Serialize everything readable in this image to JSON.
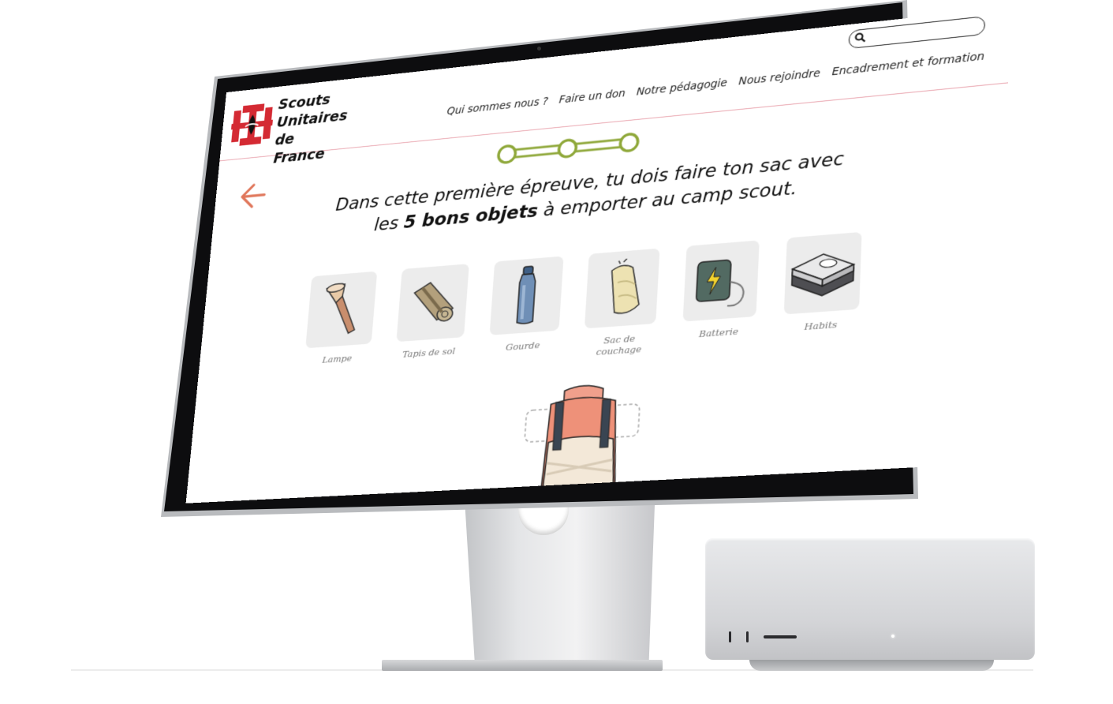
{
  "site": {
    "brand_lines": [
      "Scouts",
      "Unitaires de",
      "France"
    ],
    "search": {
      "placeholder": ""
    },
    "nav": [
      {
        "label": "Qui sommes nous ?"
      },
      {
        "label": "Faire un don"
      },
      {
        "label": "Notre pédagogie"
      },
      {
        "label": "Nous rejoindre"
      },
      {
        "label": "Encadrement et formation"
      }
    ]
  },
  "game": {
    "progress": {
      "steps": 3
    },
    "instruction": {
      "line1": "Dans cette première épreuve, tu dois faire ton sac avec",
      "line2_prefix": "les ",
      "line2_bold": "5 bons objets",
      "line2_suffix": " à emporter au camp scout."
    },
    "items": [
      {
        "label": "Lampe",
        "icon": "flashlight-icon"
      },
      {
        "label": "Tapis de sol",
        "icon": "sleeping-mat-icon"
      },
      {
        "label": "Gourde",
        "icon": "water-bottle-icon"
      },
      {
        "label": "Sac de couchage",
        "icon": "sleeping-bag-icon"
      },
      {
        "label": "Batterie",
        "icon": "power-bank-icon"
      },
      {
        "label": "Habits",
        "icon": "clothes-icon"
      }
    ],
    "bag_icon": "backpack-icon"
  },
  "colors": {
    "accent_red": "#d42a33",
    "progress_green": "#8fa83a",
    "arrow_orange": "#e0765a",
    "header_rule": "#e9a3ad"
  }
}
